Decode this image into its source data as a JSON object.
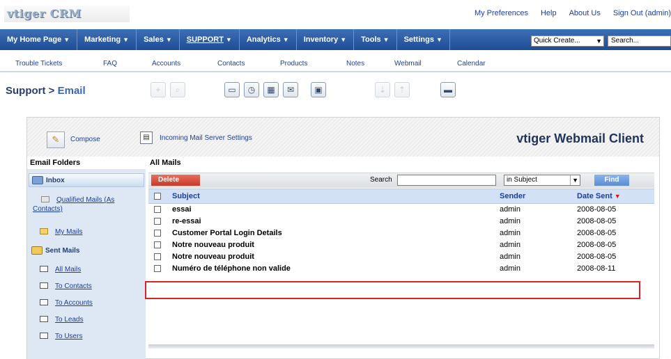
{
  "app": {
    "logo_text": "vtiger CRM"
  },
  "toplinks": [
    "My Preferences",
    "Help",
    "About Us",
    "Sign Out (admin)"
  ],
  "mainnav": {
    "tabs": [
      {
        "label": "My Home Page",
        "active": false
      },
      {
        "label": "Marketing",
        "active": false
      },
      {
        "label": "Sales",
        "active": false
      },
      {
        "label": "SUPPORT",
        "active": true
      },
      {
        "label": "Analytics",
        "active": false
      },
      {
        "label": "Inventory",
        "active": false
      },
      {
        "label": "Tools",
        "active": false
      },
      {
        "label": "Settings",
        "active": false
      }
    ],
    "quick_create": "Quick Create...",
    "search": "Search..."
  },
  "subnav": [
    "Trouble Tickets",
    "FAQ",
    "Accounts",
    "Contacts",
    "Products",
    "Notes",
    "Webmail",
    "Calendar"
  ],
  "page": {
    "section": "Support",
    "separator": " > ",
    "title": "Email"
  },
  "webmail": {
    "compose": "Compose",
    "server_settings": "Incoming Mail Server Settings",
    "client_title": "vtiger Webmail Client",
    "folders_heading": "Email Folders",
    "all_mails_heading": "All Mails",
    "inbox": "Inbox",
    "qualified_1": "Qualified Mails (As",
    "qualified_2": "Contacts)",
    "my_mails": "My Mails",
    "sent_mails": "Sent Mails",
    "sent_items": [
      "All Mails",
      "To Contacts",
      "To Accounts",
      "To Leads",
      "To Users"
    ],
    "delete": "Delete",
    "search_label": "Search",
    "search_value": "",
    "search_scope": "in Subject",
    "find": "Find",
    "columns": {
      "subject": "Subject",
      "sender": "Sender",
      "date": "Date Sent"
    },
    "mails": [
      {
        "subject": "essai",
        "sender": "admin",
        "date": "2008-08-05"
      },
      {
        "subject": "re-essai",
        "sender": "admin",
        "date": "2008-08-05"
      },
      {
        "subject": "Customer Portal Login Details",
        "sender": "admin",
        "date": "2008-08-05"
      },
      {
        "subject": "Notre nouveau produit",
        "sender": "admin",
        "date": "2008-08-05"
      },
      {
        "subject": "Notre nouveau produit",
        "sender": "admin",
        "date": "2008-08-05"
      },
      {
        "subject": "Numéro de téléphone non valide",
        "sender": "admin",
        "date": "2008-08-11"
      }
    ],
    "highlighted_row": 5
  },
  "colors": {
    "nav": "#1e4d95",
    "link": "#1c3e9e",
    "highlight": "#d8232a",
    "sidebar": "#dde8f4"
  }
}
